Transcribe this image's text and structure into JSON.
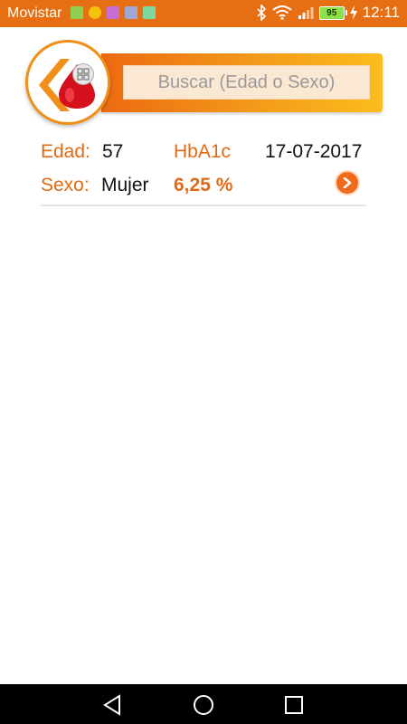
{
  "status_bar": {
    "carrier": "Movistar",
    "battery": "95",
    "time": "12:11"
  },
  "search": {
    "placeholder": "Buscar (Edad o Sexo)"
  },
  "record": {
    "age_label": "Edad:",
    "age_value": "57",
    "hba1c_label": "HbA1c",
    "date": "17-07-2017",
    "sex_label": "Sexo:",
    "sex_value": "Mujer",
    "hba1c_value": "6,25 %"
  },
  "colors": {
    "accent": "#e56f12",
    "brand_red": "#d4101d"
  }
}
